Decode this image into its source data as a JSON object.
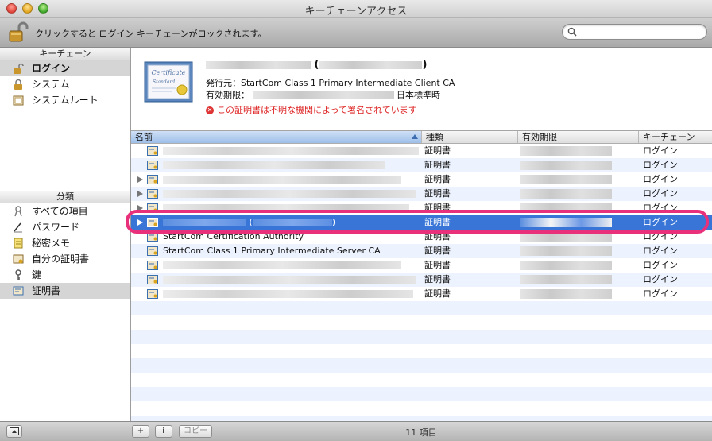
{
  "window": {
    "title": "キーチェーンアクセス"
  },
  "toolbar": {
    "lock_message": "クリックすると ログイン キーチェーンがロックされます。",
    "search_placeholder": ""
  },
  "sidebar": {
    "keychains_header": "キーチェーン",
    "keychains": [
      {
        "label": "ログイン",
        "icon": "login-keychain-icon",
        "selected": true
      },
      {
        "label": "システム",
        "icon": "system-lock-icon"
      },
      {
        "label": "システムルート",
        "icon": "system-roots-icon"
      }
    ],
    "category_header": "分類",
    "categories": [
      {
        "label": "すべての項目",
        "icon": "all-items-icon"
      },
      {
        "label": "パスワード",
        "icon": "password-icon"
      },
      {
        "label": "秘密メモ",
        "icon": "secure-note-icon"
      },
      {
        "label": "自分の証明書",
        "icon": "my-certificate-icon"
      },
      {
        "label": "鍵",
        "icon": "key-icon"
      },
      {
        "label": "証明書",
        "icon": "certificate-icon",
        "selected": true
      }
    ]
  },
  "detail": {
    "name_suffix": "(",
    "name_end": ")",
    "issuer": "発行元：StartCom Class 1 Primary Intermediate Client CA",
    "expiry_prefix": "有効期限：",
    "expiry_suffix": "日本標準時",
    "error": "この証明書は不明な機関によって署名されています",
    "cert_image_text_1": "Certificate",
    "cert_image_text_2": "Standard"
  },
  "table": {
    "columns": {
      "name": "名前",
      "kind": "種類",
      "expires": "有効期限",
      "keychain": "キーチェーン"
    },
    "rows": [
      {
        "name": "",
        "kind": "証明書",
        "keychain": "ログイン",
        "expand": false
      },
      {
        "name": "",
        "kind": "証明書",
        "keychain": "ログイン",
        "expand": false
      },
      {
        "name": "",
        "kind": "証明書",
        "keychain": "ログイン",
        "expand": true
      },
      {
        "name": "",
        "kind": "証明書",
        "keychain": "ログイン",
        "expand": true
      },
      {
        "name": "",
        "kind": "証明書",
        "keychain": "ログイン",
        "expand": true
      },
      {
        "name": "(",
        "name_end": ")",
        "kind": "証明書",
        "keychain": "ログイン",
        "expand": true,
        "selected": true
      },
      {
        "name": "StartCom Certification Authority",
        "kind": "証明書",
        "keychain": "ログイン",
        "expand": false
      },
      {
        "name": "StartCom Class 1 Primary Intermediate Server CA",
        "kind": "証明書",
        "keychain": "ログイン",
        "expand": false
      },
      {
        "name": "",
        "kind": "証明書",
        "keychain": "ログイン",
        "expand": false
      },
      {
        "name": "",
        "kind": "証明書",
        "keychain": "ログイン",
        "expand": false
      },
      {
        "name": "",
        "kind": "証明書",
        "keychain": "ログイン",
        "expand": false
      }
    ]
  },
  "bottombar": {
    "add": "+",
    "info": "i",
    "copy": "コピー",
    "count": "11 項目"
  },
  "colors": {
    "selection": "#3875d7",
    "highlight": "#e8317a",
    "error": "#dd2222"
  }
}
